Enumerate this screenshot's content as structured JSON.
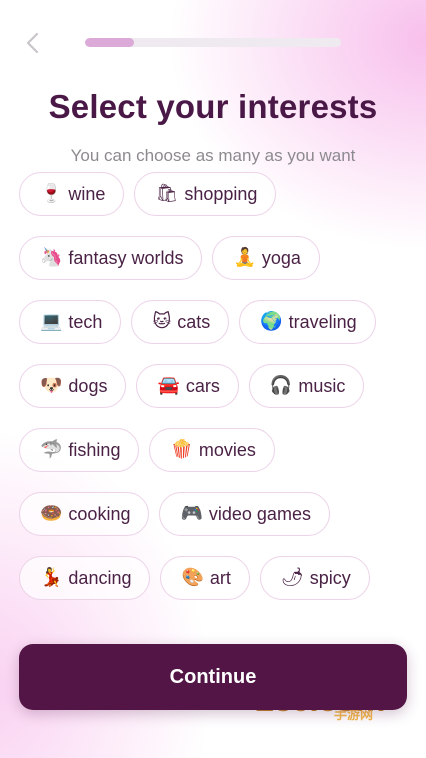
{
  "header": {
    "back_icon": "chevron-left-icon",
    "progress_fraction": 0.19
  },
  "title": "Select your interests",
  "subtitle": "You can choose as many as you want",
  "interests": [
    {
      "emoji": "🍷",
      "label": "wine"
    },
    {
      "emoji": "🛍",
      "label": "shopping"
    },
    {
      "emoji": "🦄",
      "label": "fantasy worlds"
    },
    {
      "emoji": "🧘",
      "label": "yoga"
    },
    {
      "emoji": "💻",
      "label": "tech"
    },
    {
      "emoji": "🐱",
      "label": "cats"
    },
    {
      "emoji": "🌍",
      "label": "traveling"
    },
    {
      "emoji": "🐶",
      "label": "dogs"
    },
    {
      "emoji": "🚘",
      "label": "cars"
    },
    {
      "emoji": "🎧",
      "label": "music"
    },
    {
      "emoji": "🦈",
      "label": "fishing"
    },
    {
      "emoji": "🍿",
      "label": "movies"
    },
    {
      "emoji": "🍩",
      "label": "cooking"
    },
    {
      "emoji": "🎮",
      "label": "video games"
    },
    {
      "emoji": "💃",
      "label": "dancing"
    },
    {
      "emoji": "🎨",
      "label": "art"
    },
    {
      "emoji": "🌶",
      "label": "spicy"
    }
  ],
  "continue_label": "Continue",
  "watermark": {
    "main": "289.com",
    "sub": "手游网"
  },
  "colors": {
    "title": "#4a1846",
    "button": "#521546",
    "chip_border": "#ecd3e8",
    "progress_fill": "#dcaad8"
  }
}
